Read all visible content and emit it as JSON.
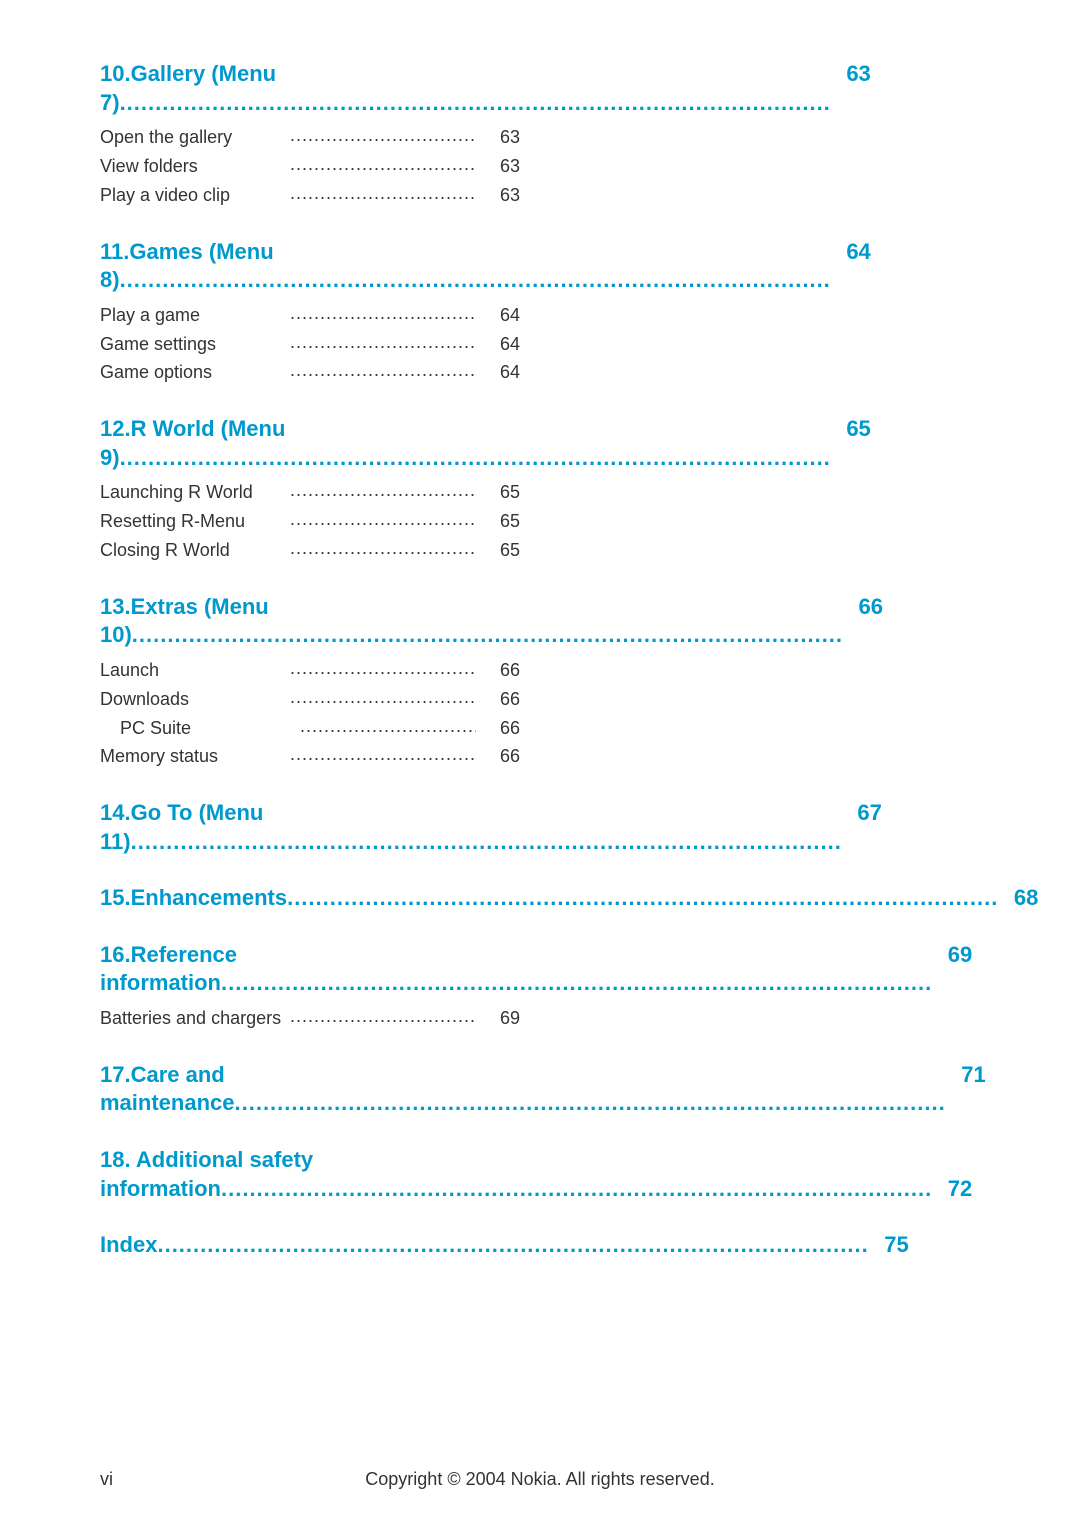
{
  "toc": {
    "sections": [
      {
        "id": "section-10",
        "title": "10.Gallery (Menu 7)..................",
        "title_text": "10.Gallery (Menu 7)",
        "page": "63",
        "subitems": [
          {
            "text": "Open the gallery",
            "dots": true,
            "page": "63",
            "indented": false
          },
          {
            "text": "View folders",
            "dots": true,
            "page": "63",
            "indented": false
          },
          {
            "text": "Play a video clip",
            "dots": true,
            "page": "63",
            "indented": false
          }
        ]
      },
      {
        "id": "section-11",
        "title": "11.Games (Menu 8)..................",
        "title_text": "11.Games (Menu 8)",
        "page": "64",
        "subitems": [
          {
            "text": "Play a game",
            "dots": true,
            "page": "64",
            "indented": false
          },
          {
            "text": "Game settings",
            "dots": true,
            "page": "64",
            "indented": false
          },
          {
            "text": "Game options",
            "dots": true,
            "page": "64",
            "indented": false
          }
        ]
      },
      {
        "id": "section-12",
        "title": "12.R World (Menu 9)................",
        "title_text": "12.R World (Menu 9)",
        "page": "65",
        "subitems": [
          {
            "text": "Launching R World",
            "dots": true,
            "page": "65",
            "indented": false
          },
          {
            "text": "Resetting R-Menu",
            "dots": true,
            "page": "65",
            "indented": false
          },
          {
            "text": "Closing R World",
            "dots": true,
            "page": "65",
            "indented": false
          }
        ]
      },
      {
        "id": "section-13",
        "title": "13.Extras (Menu 10)................",
        "title_text": "13.Extras (Menu 10)",
        "page": "66",
        "subitems": [
          {
            "text": "Launch",
            "dots": true,
            "page": "66",
            "indented": false
          },
          {
            "text": "Downloads",
            "dots": true,
            "page": "66",
            "indented": false
          },
          {
            "text": "PC Suite",
            "dots": true,
            "page": "66",
            "indented": true
          },
          {
            "text": "Memory status",
            "dots": true,
            "page": "66",
            "indented": false
          }
        ]
      },
      {
        "id": "section-14",
        "title": "14.Go To (Menu 11)..................",
        "title_text": "14.Go To (Menu 11)",
        "page": "67",
        "subitems": []
      },
      {
        "id": "section-15",
        "title": "15.Enhancements ....................",
        "title_text": "15.Enhancements",
        "page": "68",
        "subitems": []
      },
      {
        "id": "section-16",
        "title": "16.Reference information ..........",
        "title_text": "16.Reference information",
        "page": "69",
        "subitems": [
          {
            "text": "Batteries and chargers",
            "dots": true,
            "page": "69",
            "indented": false
          }
        ]
      },
      {
        "id": "section-17",
        "title": "17.Care and maintenance ..........",
        "title_text": "17.Care and maintenance",
        "page": "71",
        "subitems": []
      },
      {
        "id": "section-18",
        "title": "18. Additional safety information ..............................",
        "title_text": "18. Additional safety\ninformation",
        "page": "72",
        "subitems": [],
        "multiline": true
      },
      {
        "id": "section-index",
        "title": "Index .........................................",
        "title_text": "Index",
        "page": "75",
        "subitems": [],
        "is_index": true
      }
    ]
  },
  "footer": {
    "page_label": "vi",
    "copyright": "Copyright © 2004 Nokia. All rights reserved."
  },
  "colors": {
    "heading": "#0099cc",
    "body": "#333333",
    "page_num": "#0099cc"
  }
}
